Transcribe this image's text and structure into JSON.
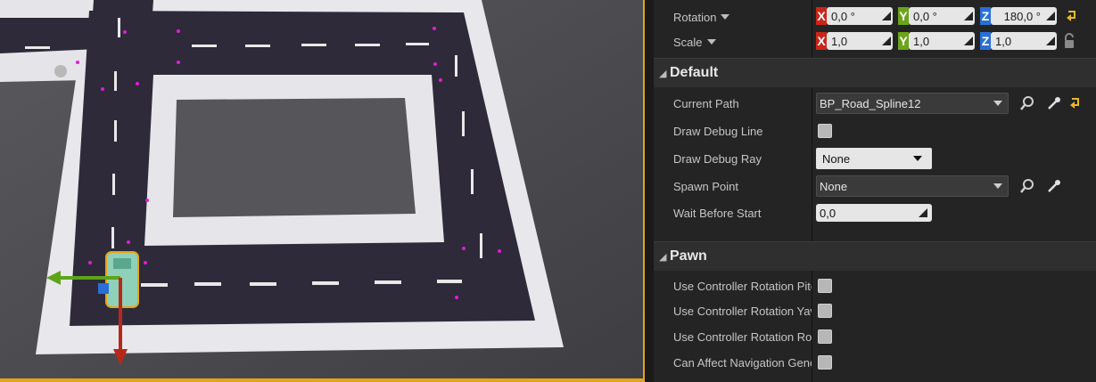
{
  "transform": {
    "rotation": {
      "label": "Rotation",
      "x": "0,0 °",
      "y": "0,0 °",
      "z": "180,0 °"
    },
    "scale": {
      "label": "Scale",
      "x": "1,0",
      "y": "1,0",
      "z": "1,0"
    },
    "axis_tags": {
      "x": "X",
      "y": "Y",
      "z": "Z"
    }
  },
  "default_section": {
    "title": "Default",
    "current_path": {
      "label": "Current Path",
      "value": "BP_Road_Spline12"
    },
    "draw_debug_line": {
      "label": "Draw Debug Line",
      "checked": false
    },
    "draw_debug_ray": {
      "label": "Draw Debug Ray",
      "value": "None"
    },
    "spawn_point": {
      "label": "Spawn Point",
      "value": "None"
    },
    "wait_before_start": {
      "label": "Wait Before Start",
      "value": "0,0"
    }
  },
  "pawn_section": {
    "title": "Pawn",
    "items": [
      {
        "label": "Use Controller Rotation Pitc",
        "checked": false
      },
      {
        "label": "Use Controller Rotation Yav",
        "checked": false
      },
      {
        "label": "Use Controller Rotation Rol",
        "checked": false
      },
      {
        "label": "Can Affect Navigation Gene",
        "checked": false
      }
    ]
  },
  "colors": {
    "axis_x": "#c8261a",
    "axis_y": "#6ba41a",
    "axis_z": "#2a6fd6",
    "viewport_border": "#e2a51a",
    "reset_arrow": "#e8b92a"
  }
}
